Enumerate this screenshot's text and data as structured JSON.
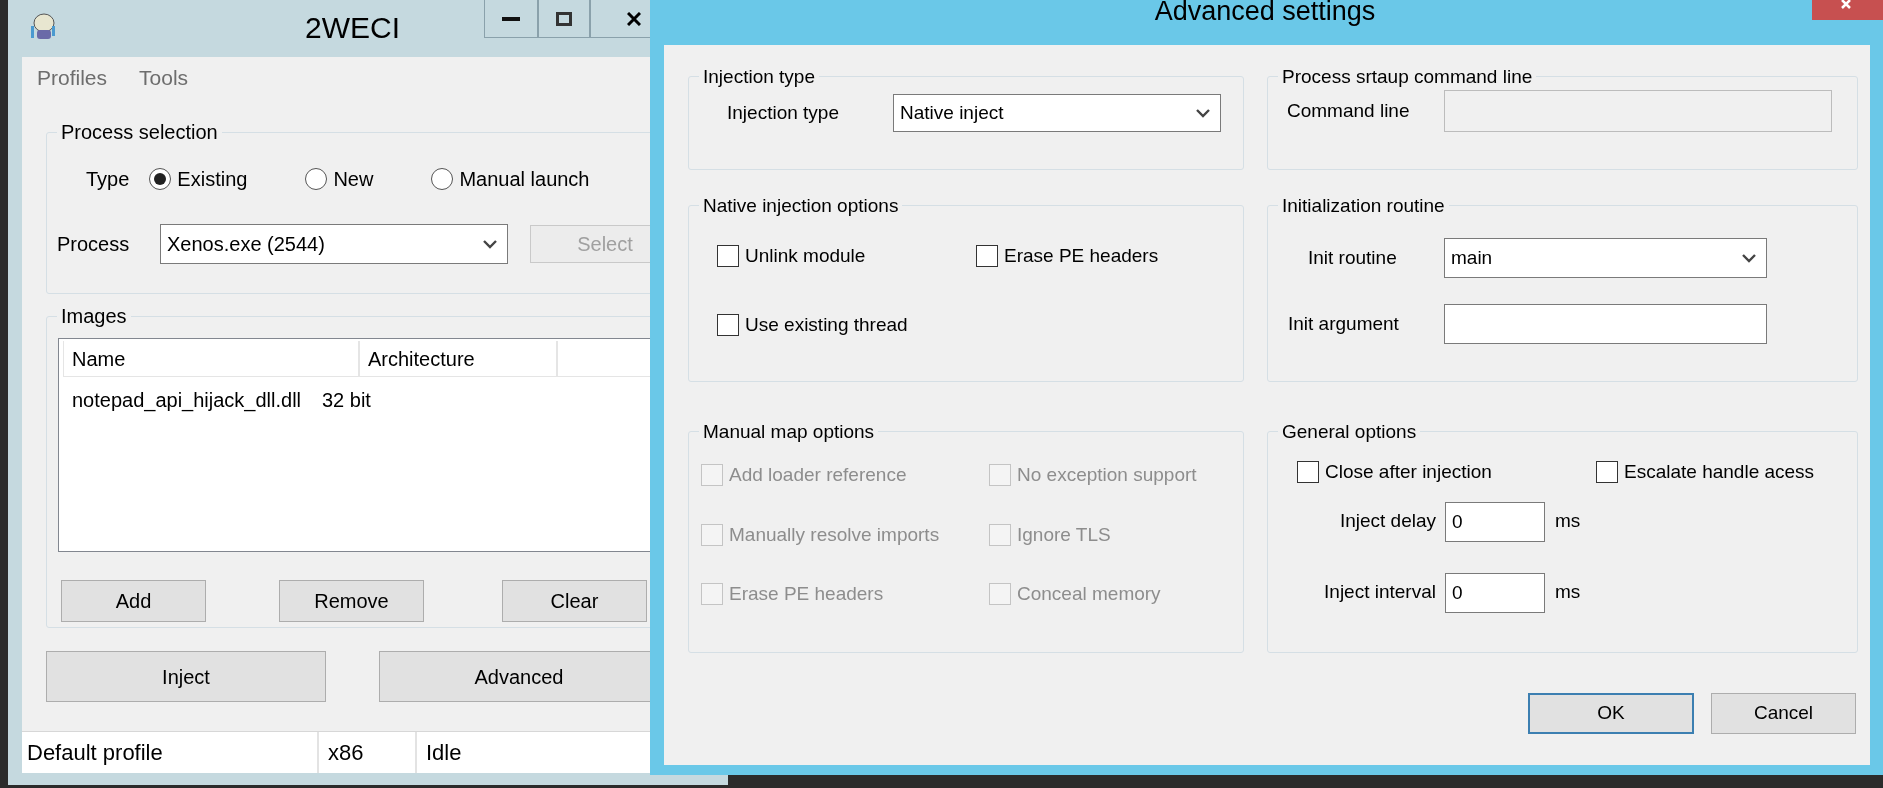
{
  "main_window": {
    "title": "2WECI",
    "menu": [
      "Profiles",
      "Tools"
    ],
    "process_selection": {
      "title": "Process selection",
      "type_label": "Type",
      "types": [
        {
          "label": "Existing",
          "selected": true
        },
        {
          "label": "New",
          "selected": false
        },
        {
          "label": "Manual launch",
          "selected": false
        }
      ],
      "process_label": "Process",
      "process_value": "Xenos.exe (2544)",
      "select_button": {
        "label": "Select",
        "disabled": true
      }
    },
    "images": {
      "title": "Images",
      "columns": [
        "Name",
        "Architecture"
      ],
      "rows": [
        {
          "name": "notepad_api_hijack_dll.dll",
          "architecture": "32 bit"
        }
      ],
      "buttons": [
        "Add",
        "Remove",
        "Clear"
      ]
    },
    "buttons": [
      "Inject",
      "Advanced"
    ],
    "status_bar": [
      "Default profile",
      "x86",
      "Idle"
    ]
  },
  "dialog": {
    "title": "Advanced settings",
    "injection_type": {
      "title": "Injection type",
      "label": "Injection type",
      "value": "Native inject"
    },
    "startup": {
      "title": "Process srtaup command line",
      "label": "Command line",
      "disabled": true
    },
    "native_options": {
      "title": "Native injection options",
      "options": [
        {
          "label": "Unlink module",
          "checked": false,
          "disabled": false
        },
        {
          "label": "Erase PE headers",
          "checked": false,
          "disabled": false
        },
        {
          "label": "Use existing thread",
          "checked": false,
          "disabled": false
        }
      ]
    },
    "init": {
      "title": "Initialization routine",
      "routine_label": "Init routine",
      "routine_value": "main",
      "argument_label": "Init argument"
    },
    "manual_map": {
      "title": "Manual map options",
      "options": [
        {
          "label": "Add loader reference",
          "checked": false,
          "disabled": true
        },
        {
          "label": "No exception support",
          "checked": false,
          "disabled": true
        },
        {
          "label": "Manually resolve imports",
          "checked": false,
          "disabled": true
        },
        {
          "label": "Ignore TLS",
          "checked": false,
          "disabled": true
        },
        {
          "label": "Erase PE headers",
          "checked": false,
          "disabled": true
        },
        {
          "label": "Conceal memory",
          "checked": false,
          "disabled": true
        }
      ]
    },
    "general": {
      "title": "General options",
      "options": [
        {
          "label": "Close after injection",
          "checked": false,
          "disabled": false
        },
        {
          "label": "Escalate handle acess",
          "checked": false,
          "disabled": false
        }
      ],
      "fields": [
        {
          "label": "Inject delay",
          "value": "0",
          "unit": "ms"
        },
        {
          "label": "Inject interval",
          "value": "0",
          "unit": "ms"
        }
      ]
    },
    "buttons": [
      {
        "label": "OK",
        "default": true
      },
      {
        "label": "Cancel",
        "default": false
      }
    ]
  }
}
